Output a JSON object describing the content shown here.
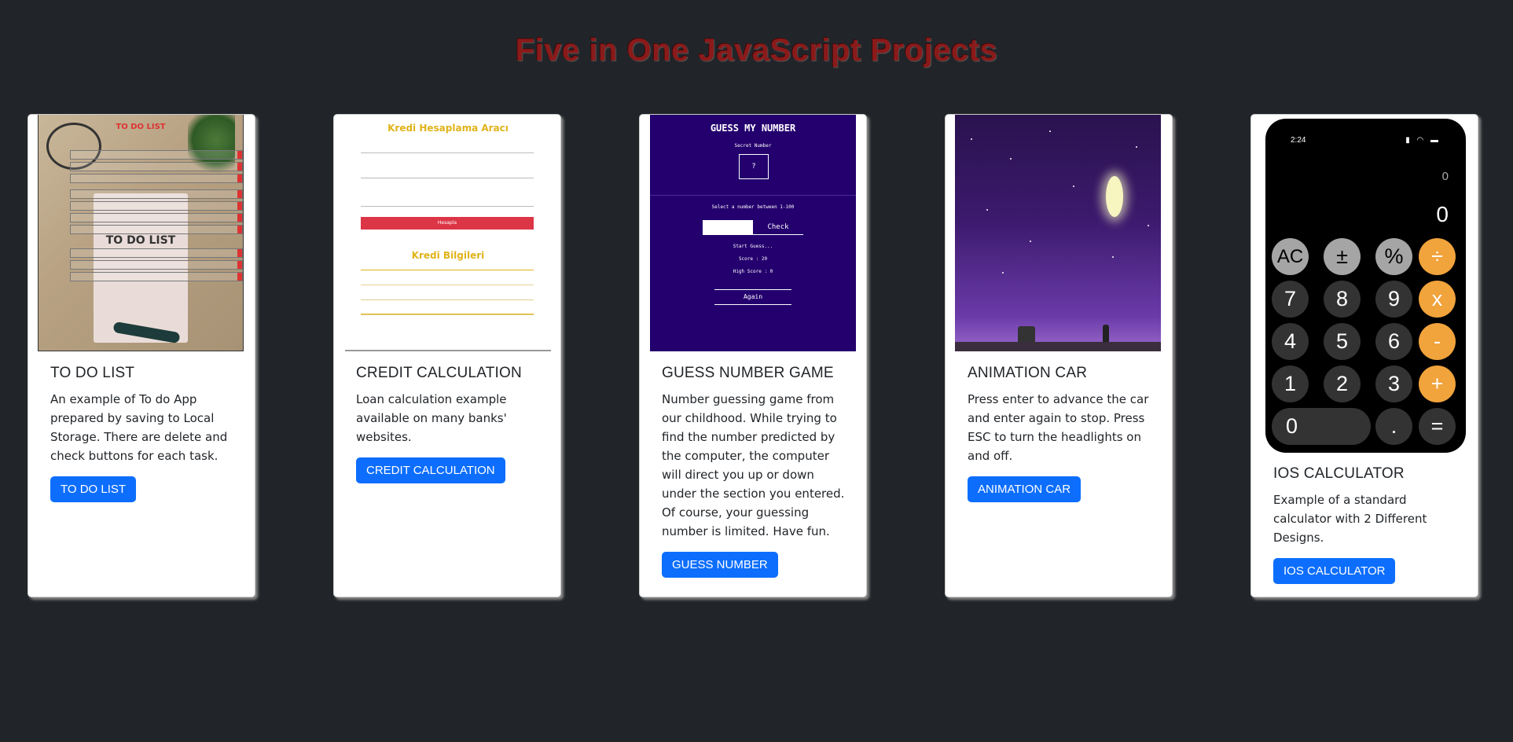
{
  "page": {
    "title": "Five in One JavaScript Projects"
  },
  "cards": [
    {
      "title": "TO DO LIST",
      "text": "An example of To do App prepared by saving to Local Storage. There are delete and check buttons for each task.",
      "button": "TO DO LIST",
      "preview": {
        "heading": "TO DO LIST",
        "notebook_text": "TO DO LIST"
      }
    },
    {
      "title": "CREDIT CALCULATION",
      "text": "Loan calculation example available on many banks' websites.",
      "button": "CREDIT CALCULATION",
      "preview": {
        "heading": "Kredi Hesaplama Aracı",
        "button": "Hesapla",
        "subheading": "Kredi Bilgileri"
      }
    },
    {
      "title": "GUESS NUMBER GAME",
      "text": "Number guessing game from our childhood. While trying to find the number predicted by the computer, the computer will direct you up or down under the section you entered. Of course, your guessing number is limited. Have fun.",
      "button": "GUESS NUMBER",
      "preview": {
        "heading": "GUESS MY NUMBER",
        "secret_label": "Secret Number",
        "secret_value": "?",
        "prompt": "Select a number between 1-100",
        "check": "Check",
        "start": "Start Guess...",
        "score": "Score : 20",
        "highscore": "High Score : 0",
        "again": "Again"
      }
    },
    {
      "title": "ANIMATION CAR",
      "text": "Press enter to advance the car and enter again to stop. Press ESC to turn the headlights on and off.",
      "button": "ANIMATION CAR"
    },
    {
      "title": "IOS CALCULATOR",
      "text": "Example of a standard calculator with 2 Different Designs.",
      "button": "IOS CALCULATOR",
      "preview": {
        "time": "2:24",
        "previous": "0",
        "display": "0",
        "keys": [
          "AC",
          "±",
          "%",
          "÷",
          "7",
          "8",
          "9",
          "x",
          "4",
          "5",
          "6",
          "-",
          "1",
          "2",
          "3",
          "+",
          "0",
          ".",
          "="
        ]
      }
    }
  ],
  "colors": {
    "background": "#212529",
    "title": "#8b1a1a",
    "button": "#0d6efd",
    "calc_orange": "#f1a33c",
    "calc_grey": "#a5a5a5",
    "calc_dark": "#333333"
  }
}
